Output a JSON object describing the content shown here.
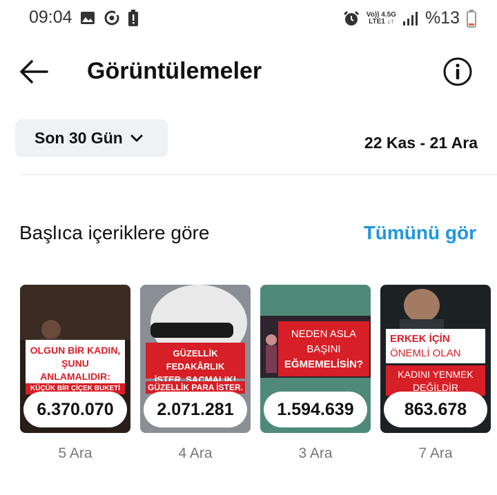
{
  "status_bar": {
    "time": "09:04",
    "net_top": "Vo)) 4.5G",
    "net_bottom": "LTE1 ↓↑",
    "battery": "%13",
    "icons": [
      "image-icon",
      "sync-icon",
      "battery-alert-icon",
      "alarm-icon",
      "signal-icon",
      "battery-icon"
    ]
  },
  "header": {
    "title": "Görüntülemeler"
  },
  "filter": {
    "label": "Son 30 Gün",
    "date_range": "22 Kas - 21 Ara"
  },
  "section": {
    "title": "Başlıca içeriklere göre",
    "see_all": "Tümünü gör"
  },
  "cards": [
    {
      "views": "6.370.070",
      "date": "5 Ara",
      "thumb_text": [
        "OLGUN BİR KADIN,",
        "ŞUNU ANLAMALIDIR:",
        "KÜÇÜK BİR ÇİÇEK BUKETİ"
      ]
    },
    {
      "views": "2.071.281",
      "date": "4 Ara",
      "thumb_text": [
        "GÜZELLİK FEDAKÂRLIK",
        "İSTER. SAÇMALIK!",
        "GÜZELLİK PARA İSTER."
      ]
    },
    {
      "views": "1.594.639",
      "date": "3 Ara",
      "thumb_text": [
        "NEDEN ASLA",
        "BAŞINI",
        "EĞMEMELİSİN?"
      ]
    },
    {
      "views": "863.678",
      "date": "7 Ara",
      "thumb_text": [
        "ERKEK İÇİN",
        "ÖNEMLİ OLAN",
        "KADINI YENMEK",
        "DEĞİLDİR"
      ]
    }
  ],
  "colors": {
    "accent_link": "#1f96e0",
    "banner_red": "#d61f26",
    "filter_bg": "#eff2f5"
  }
}
